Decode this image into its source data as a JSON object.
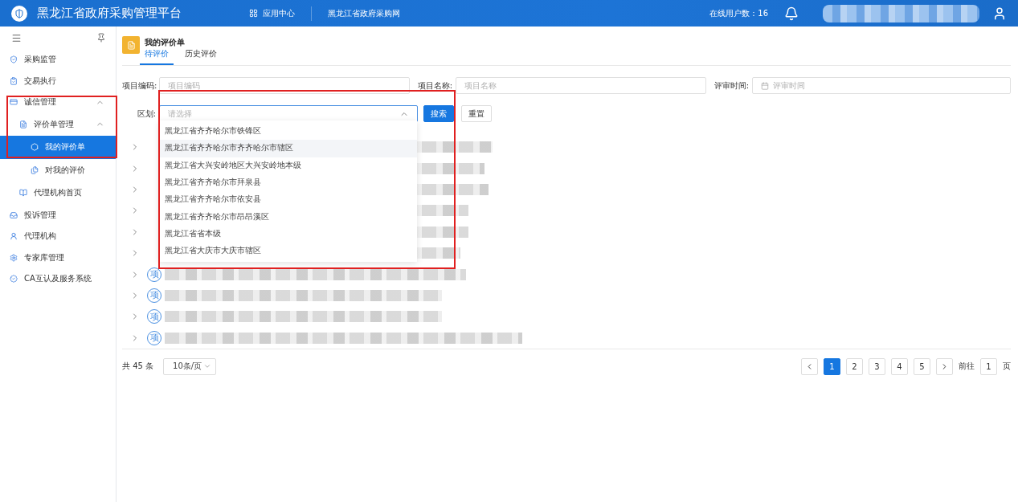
{
  "header": {
    "title": "黑龙江省政府采购管理平台",
    "app_center": "应用中心",
    "site_link": "黑龙江省政府采购网",
    "online_users": "在线用户数：16"
  },
  "sidebar": {
    "items": [
      {
        "label": "采购监管"
      },
      {
        "label": "交易执行"
      },
      {
        "label": "诚信管理",
        "expanded": true,
        "children": [
          {
            "label": "评价单管理",
            "expanded": true,
            "children": [
              {
                "label": "我的评价单",
                "selected": true
              },
              {
                "label": "对我的评价",
                "selected": false
              }
            ]
          },
          {
            "label": "代理机构首页"
          }
        ]
      },
      {
        "label": "投诉管理"
      },
      {
        "label": "代理机构"
      },
      {
        "label": "专家库管理"
      },
      {
        "label": "CA互认及服务系统"
      }
    ]
  },
  "page": {
    "title": "我的评价单",
    "tabs": [
      {
        "label": "待评价",
        "selected": true
      },
      {
        "label": "历史评价",
        "selected": false
      }
    ]
  },
  "filters": {
    "fields": [
      {
        "label": "项目编码:",
        "placeholder": "项目编码"
      },
      {
        "label": "项目名称:",
        "placeholder": "项目名称"
      },
      {
        "label": "评审时间:",
        "placeholder": "评审时间",
        "kind": "date"
      }
    ],
    "region": {
      "label": "区划:",
      "placeholder": "请选择",
      "open": true,
      "options": [
        {
          "label": "黑龙江省齐齐哈尔市铁锋区",
          "highlighted": false
        },
        {
          "label": "黑龙江省齐齐哈尔市齐齐哈尔市辖区",
          "highlighted": true
        },
        {
          "label": "黑龙江省大兴安岭地区大兴安岭地本级",
          "highlighted": false
        },
        {
          "label": "黑龙江省齐齐哈尔市拜泉县",
          "highlighted": false
        },
        {
          "label": "黑龙江省齐齐哈尔市依安县",
          "highlighted": false
        },
        {
          "label": "黑龙江省齐齐哈尔市昂昂溪区",
          "highlighted": false
        },
        {
          "label": "黑龙江省省本级",
          "highlighted": false
        },
        {
          "label": "黑龙江省大庆市大庆市辖区",
          "highlighted": false
        }
      ]
    },
    "search": "搜索",
    "reset": "重置"
  },
  "table": {
    "rows": [
      {},
      {},
      {},
      {},
      {},
      {},
      {
        "badge": "项"
      },
      {
        "badge": "项"
      },
      {
        "badge": "项"
      },
      {
        "badge": "项"
      }
    ]
  },
  "pagination": {
    "total": "共 45 条",
    "page_size": "10条/页",
    "pages": [
      {
        "label": "1",
        "selected": true
      },
      {
        "label": "2",
        "selected": false
      },
      {
        "label": "3",
        "selected": false
      },
      {
        "label": "4",
        "selected": false
      },
      {
        "label": "5",
        "selected": false
      }
    ],
    "goto_prefix": "前往",
    "goto_value": "1",
    "goto_suffix": "页"
  }
}
